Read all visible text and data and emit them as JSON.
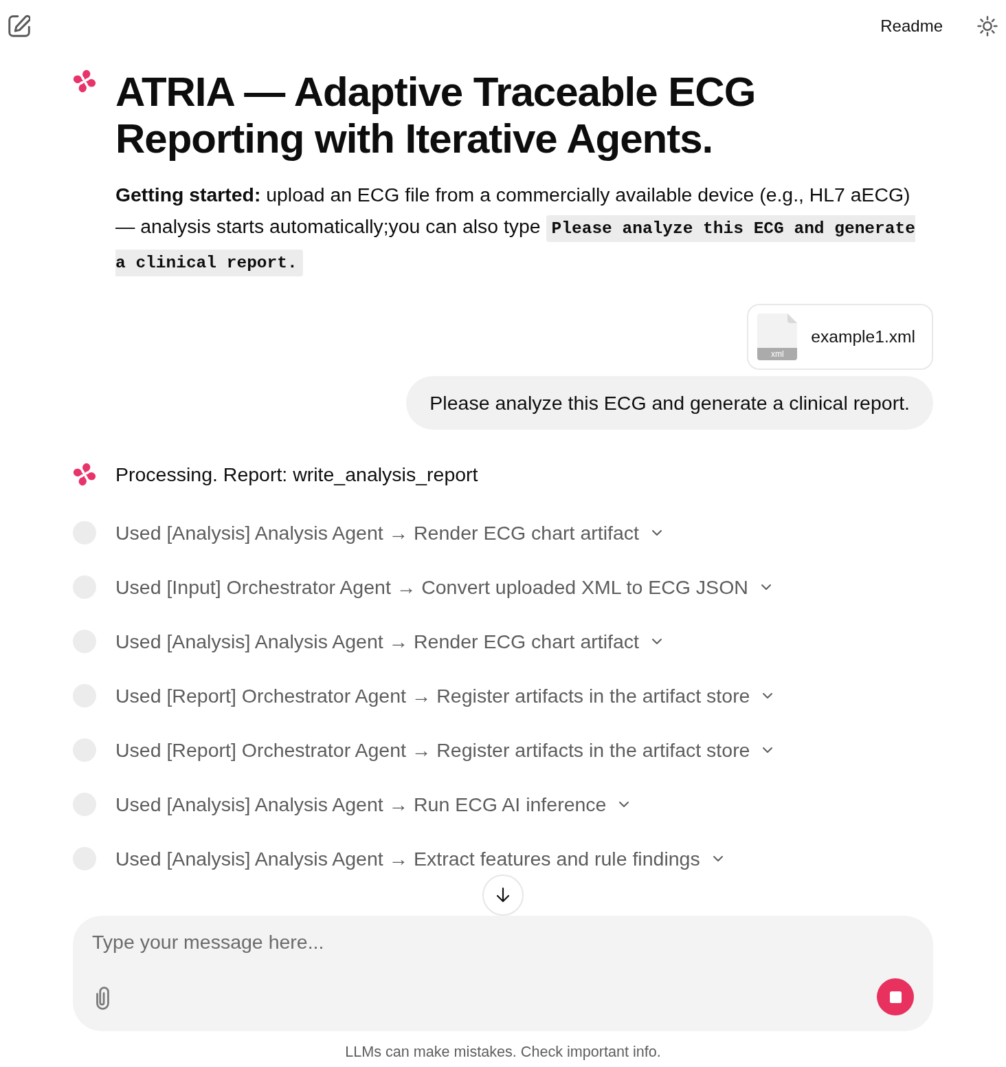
{
  "header": {
    "readme_link": "Readme"
  },
  "welcome": {
    "title": "ATRIA — Adaptive Traceable ECG Reporting with Iterative Agents.",
    "intro": "**Getting started:** upload an ECG file from a commercially available device (e.g., HL7 aECG) — analysis starts automatically;you can also type",
    "example_prompt": "Please analyze this ECG and generate a clinical report."
  },
  "messages": [
    {
      "kind": "user",
      "attachment": {
        "file_name": "example1.xml",
        "file_type": "xml"
      },
      "text": "Please analyze this ECG and generate a clinical report."
    },
    {
      "kind": "assistant",
      "text": "Processing. Report: write_analysis_report"
    }
  ],
  "tool_calls": [
    {
      "label": "Used [Analysis] Analysis Agent → Render ECG chart artifact",
      "expanded": false
    },
    {
      "label": "Used [Input] Orchestrator Agent → Convert uploaded XML to ECG JSON",
      "expanded": false
    },
    {
      "label": "Used [Analysis] Analysis Agent → Render ECG chart artifact",
      "expanded": false
    },
    {
      "label": "Used [Report] Orchestrator Agent → Register artifacts in the artifact store",
      "expanded": false
    },
    {
      "label": "Used [Report] Orchestrator Agent → Register artifacts in the artifact store",
      "expanded": false
    },
    {
      "label": "Used [Analysis] Analysis Agent → Run ECG AI inference",
      "expanded": false
    },
    {
      "label": "Used [Analysis] Analysis Agent → Extract features and rule findings",
      "expanded": false
    }
  ],
  "composer": {
    "placeholder": "Type your message here...",
    "running": true
  },
  "footer_note": "LLMs can make mistakes. Check important info."
}
